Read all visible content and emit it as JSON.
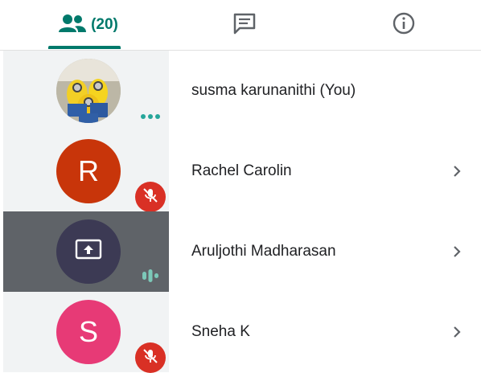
{
  "tabs": {
    "people_count": "(20)"
  },
  "participants": [
    {
      "name": "susma karunanithi (You)",
      "avatar_type": "photo",
      "status": "more-options"
    },
    {
      "name": "Rachel Carolin",
      "initial": "R",
      "avatar_color": "#c8350a",
      "status": "muted"
    },
    {
      "name": "Aruljothi Madharasan",
      "avatar_type": "presenting",
      "status": "speaking",
      "highlighted": true
    },
    {
      "name": "Sneha K",
      "initial": "S",
      "avatar_color": "#e73a76",
      "status": "muted"
    }
  ],
  "colors": {
    "accent": "#00796b",
    "muted_badge": "#d93025",
    "speaking": "#7cc8b8",
    "highlight_bg": "#5f6368"
  }
}
